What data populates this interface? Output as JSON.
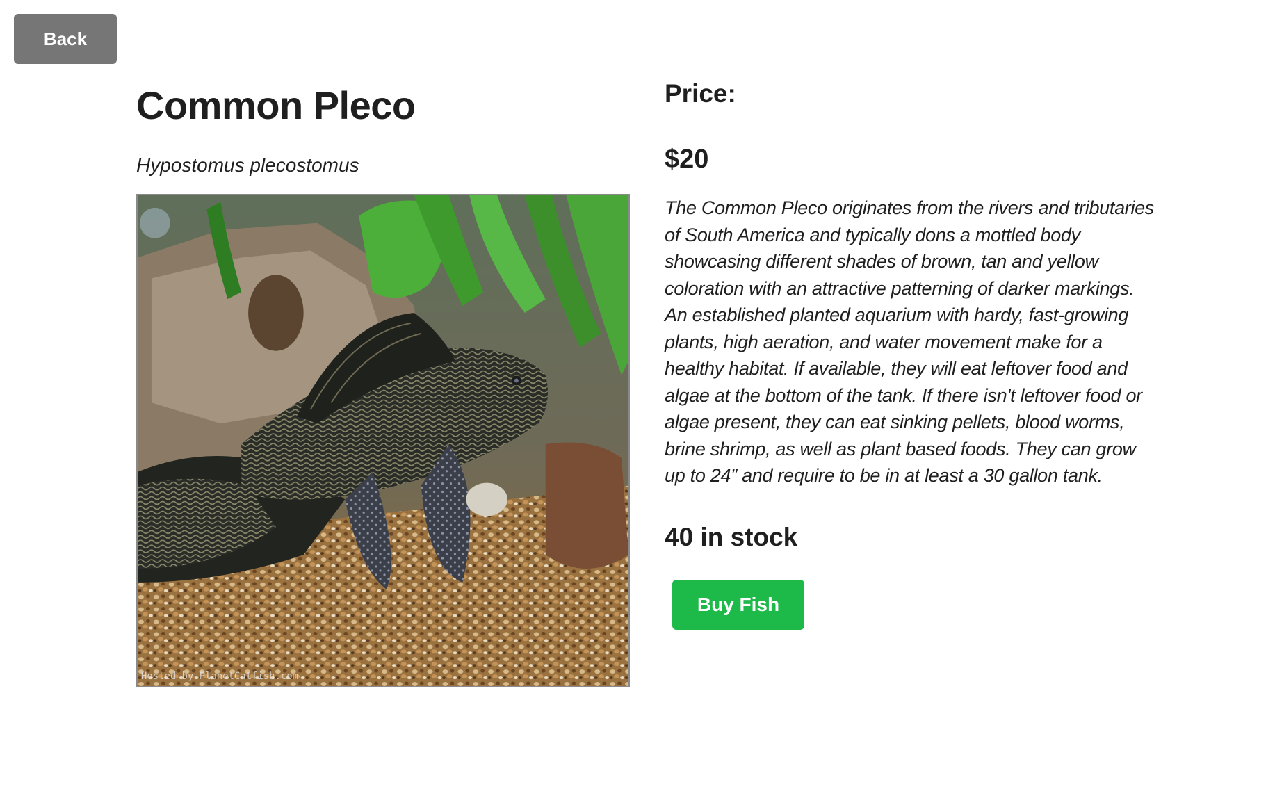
{
  "nav": {
    "back_label": "Back"
  },
  "fish": {
    "name": "Common Pleco",
    "scientific_name": "Hypostomus plecostomus",
    "image": {
      "subject": "pleco-catfish-photo",
      "watermark": "Hosted by PlanetCatfish.com"
    }
  },
  "details": {
    "price_label": "Price:",
    "price_value": "$20",
    "description": "The Common Pleco originates from the rivers and tributaries of South America and typically dons a mottled body showcasing different shades of brown, tan and yellow coloration with an attractive patterning of darker markings. An established planted aquarium with hardy, fast-growing plants, high aeration, and water movement make for a healthy habitat. If available, they will eat leftover food and algae at the bottom of the tank. If there isn't leftover food or algae present, they can eat sinking pellets, blood worms, brine shrimp, as well as plant based foods. They can grow up to 24” and require to be in at least a 30 gallon tank.",
    "stock_text": "40 in stock",
    "buy_label": "Buy Fish"
  },
  "colors": {
    "back_button": "#767676",
    "buy_button": "#1dba4a",
    "text": "#1f1f1f"
  }
}
